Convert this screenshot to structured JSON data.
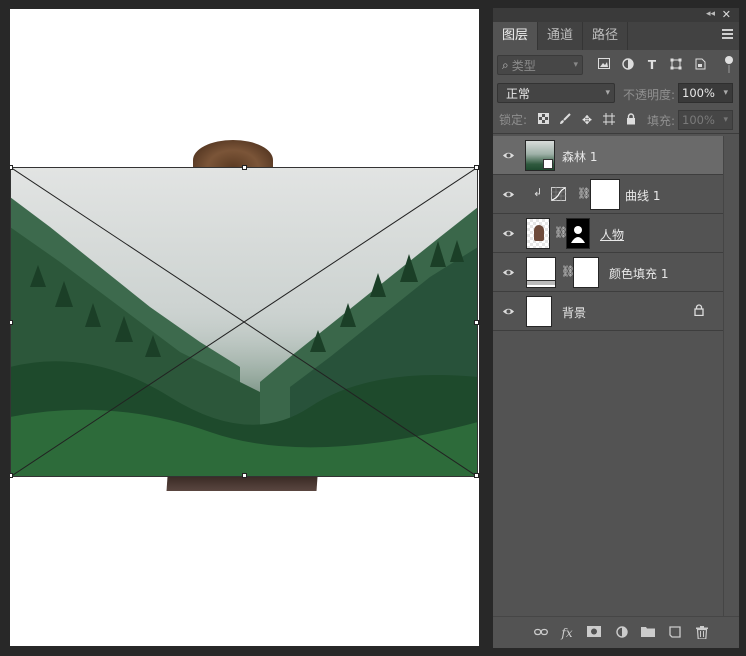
{
  "window": {
    "collapse_glyph": "◂◂",
    "close_glyph": "✕"
  },
  "panel": {
    "tabs": [
      {
        "label": "图层",
        "active": true
      },
      {
        "label": "通道",
        "active": false
      },
      {
        "label": "路径",
        "active": false
      }
    ],
    "filter": {
      "placeholder": "类型",
      "icons": [
        "image-filter-icon",
        "adjustment-filter-icon",
        "type-filter-icon",
        "shape-filter-icon",
        "smart-object-filter-icon"
      ]
    },
    "blend": {
      "mode": "正常",
      "opacity_label": "不透明度:",
      "opacity_value": "100%"
    },
    "lock": {
      "label": "锁定:",
      "fill_label": "填充:",
      "fill_value": "100%"
    },
    "layers": [
      {
        "name": "森林 1",
        "selected": true,
        "type": "smart-object"
      },
      {
        "name": "曲线 1",
        "selected": false,
        "type": "curves-adjustment",
        "clipped": true
      },
      {
        "name": "人物",
        "selected": false,
        "type": "masked-layer"
      },
      {
        "name": "颜色填充 1",
        "selected": false,
        "type": "color-fill"
      },
      {
        "name": "背景",
        "selected": false,
        "type": "background",
        "locked": true
      }
    ],
    "bottom_icons": [
      "link-layers-icon",
      "fx-icon",
      "add-mask-icon",
      "new-adjustment-icon",
      "new-group-icon",
      "new-layer-icon",
      "delete-layer-icon"
    ]
  },
  "colors": {
    "panel_bg": "#535353",
    "selected_layer": "#6a6a6a",
    "workspace": "#282828"
  }
}
